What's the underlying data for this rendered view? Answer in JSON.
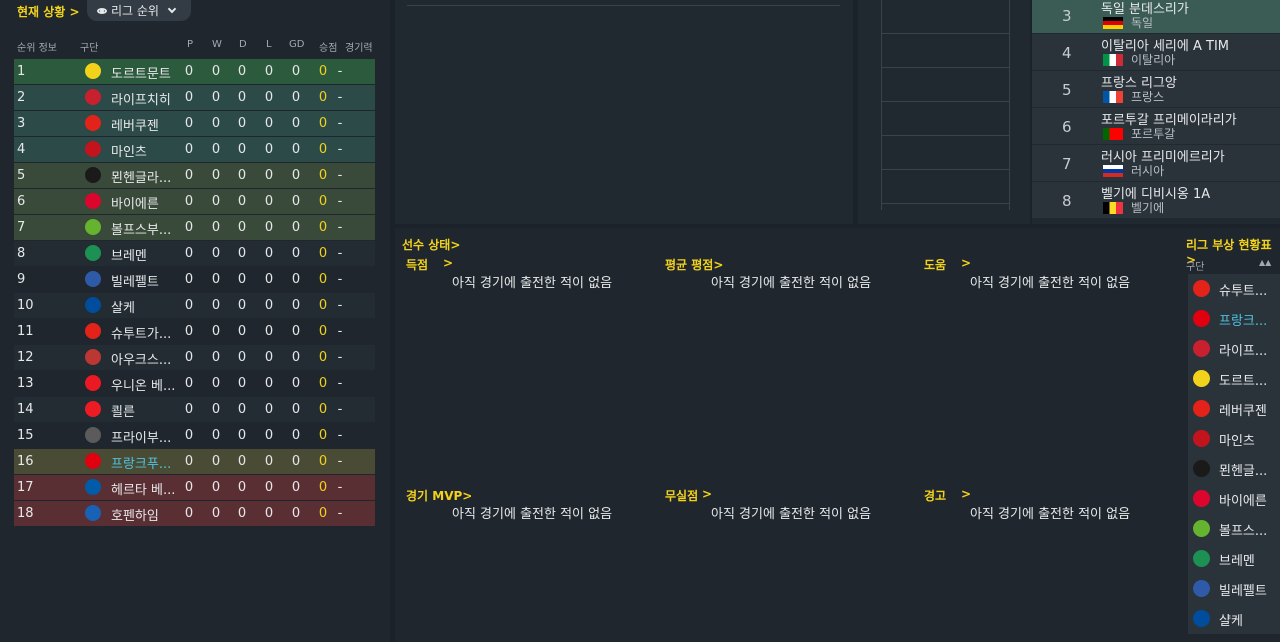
{
  "header": {
    "status_link": "현재 상황 >",
    "dropdown_label": "리그 순위"
  },
  "table_columns": {
    "pos": "순위 정보",
    "team": "구단",
    "p": "P",
    "w": "W",
    "d": "D",
    "l": "L",
    "gd": "GD",
    "pts": "승점",
    "form": "경기력"
  },
  "table_rows": [
    {
      "pos": "1",
      "team": "도르트문트",
      "p": "0",
      "w": "0",
      "d": "0",
      "l": "0",
      "gd": "0",
      "pts": "0",
      "form": "-"
    },
    {
      "pos": "2",
      "team": "라이프치히",
      "p": "0",
      "w": "0",
      "d": "0",
      "l": "0",
      "gd": "0",
      "pts": "0",
      "form": "-"
    },
    {
      "pos": "3",
      "team": "레버쿠젠",
      "p": "0",
      "w": "0",
      "d": "0",
      "l": "0",
      "gd": "0",
      "pts": "0",
      "form": "-"
    },
    {
      "pos": "4",
      "team": "마인츠",
      "p": "0",
      "w": "0",
      "d": "0",
      "l": "0",
      "gd": "0",
      "pts": "0",
      "form": "-"
    },
    {
      "pos": "5",
      "team": "묀헨글라...",
      "p": "0",
      "w": "0",
      "d": "0",
      "l": "0",
      "gd": "0",
      "pts": "0",
      "form": "-"
    },
    {
      "pos": "6",
      "team": "바이에른",
      "p": "0",
      "w": "0",
      "d": "0",
      "l": "0",
      "gd": "0",
      "pts": "0",
      "form": "-"
    },
    {
      "pos": "7",
      "team": "볼프스부...",
      "p": "0",
      "w": "0",
      "d": "0",
      "l": "0",
      "gd": "0",
      "pts": "0",
      "form": "-"
    },
    {
      "pos": "8",
      "team": "브레멘",
      "p": "0",
      "w": "0",
      "d": "0",
      "l": "0",
      "gd": "0",
      "pts": "0",
      "form": "-"
    },
    {
      "pos": "9",
      "team": "빌레펠트",
      "p": "0",
      "w": "0",
      "d": "0",
      "l": "0",
      "gd": "0",
      "pts": "0",
      "form": "-"
    },
    {
      "pos": "10",
      "team": "살케",
      "p": "0",
      "w": "0",
      "d": "0",
      "l": "0",
      "gd": "0",
      "pts": "0",
      "form": "-"
    },
    {
      "pos": "11",
      "team": "슈투트가...",
      "p": "0",
      "w": "0",
      "d": "0",
      "l": "0",
      "gd": "0",
      "pts": "0",
      "form": "-"
    },
    {
      "pos": "12",
      "team": "아우크스...",
      "p": "0",
      "w": "0",
      "d": "0",
      "l": "0",
      "gd": "0",
      "pts": "0",
      "form": "-"
    },
    {
      "pos": "13",
      "team": "우니온 베...",
      "p": "0",
      "w": "0",
      "d": "0",
      "l": "0",
      "gd": "0",
      "pts": "0",
      "form": "-"
    },
    {
      "pos": "14",
      "team": "쾰른",
      "p": "0",
      "w": "0",
      "d": "0",
      "l": "0",
      "gd": "0",
      "pts": "0",
      "form": "-"
    },
    {
      "pos": "15",
      "team": "프라이부...",
      "p": "0",
      "w": "0",
      "d": "0",
      "l": "0",
      "gd": "0",
      "pts": "0",
      "form": "-"
    },
    {
      "pos": "16",
      "team": "프랑크푸...",
      "p": "0",
      "w": "0",
      "d": "0",
      "l": "0",
      "gd": "0",
      "pts": "0",
      "form": "-"
    },
    {
      "pos": "17",
      "team": "헤르타 베...",
      "p": "0",
      "w": "0",
      "d": "0",
      "l": "0",
      "gd": "0",
      "pts": "0",
      "form": "-"
    },
    {
      "pos": "18",
      "team": "호펜하임",
      "p": "0",
      "w": "0",
      "d": "0",
      "l": "0",
      "gd": "0",
      "pts": "0",
      "form": "-"
    }
  ],
  "leagues": [
    {
      "rank": "3",
      "name": "독일 분데스리가",
      "country": "독일"
    },
    {
      "rank": "4",
      "name": "이탈리아 세리에 A TIM",
      "country": "이탈리아"
    },
    {
      "rank": "5",
      "name": "프랑스 리그앙",
      "country": "프랑스"
    },
    {
      "rank": "6",
      "name": "포르투갈 프리메이라리가",
      "country": "포르투갈"
    },
    {
      "rank": "7",
      "name": "러시아 프리미에르리가",
      "country": "러시아"
    },
    {
      "rank": "8",
      "name": "벨기에 디비시옹 1A",
      "country": "벨기에"
    }
  ],
  "player_status": {
    "title": "선수 상태>",
    "goals": "득점",
    "avg_rating": "평균 평점>",
    "assists": "도움",
    "mvp": "경기 MVP>",
    "clean_sheets": "무실점",
    "cautions": "경고",
    "empty_text": "아직 경기에 출전한 적이 없음",
    "arrow": ">"
  },
  "injury": {
    "title": "리그 부상 현황표>",
    "col_team": "구단",
    "sort_icon": "▲▲",
    "teams": [
      "슈투트...",
      "프랑크...",
      "라이프...",
      "도르트...",
      "레버쿠젠",
      "마인츠",
      "묀헨글...",
      "바이에른",
      "볼프스...",
      "브레멘",
      "빌레펠트",
      "샬케"
    ]
  },
  "colors": {
    "accent": "#f2d21b",
    "highlight_team": "#4ec3e0"
  }
}
